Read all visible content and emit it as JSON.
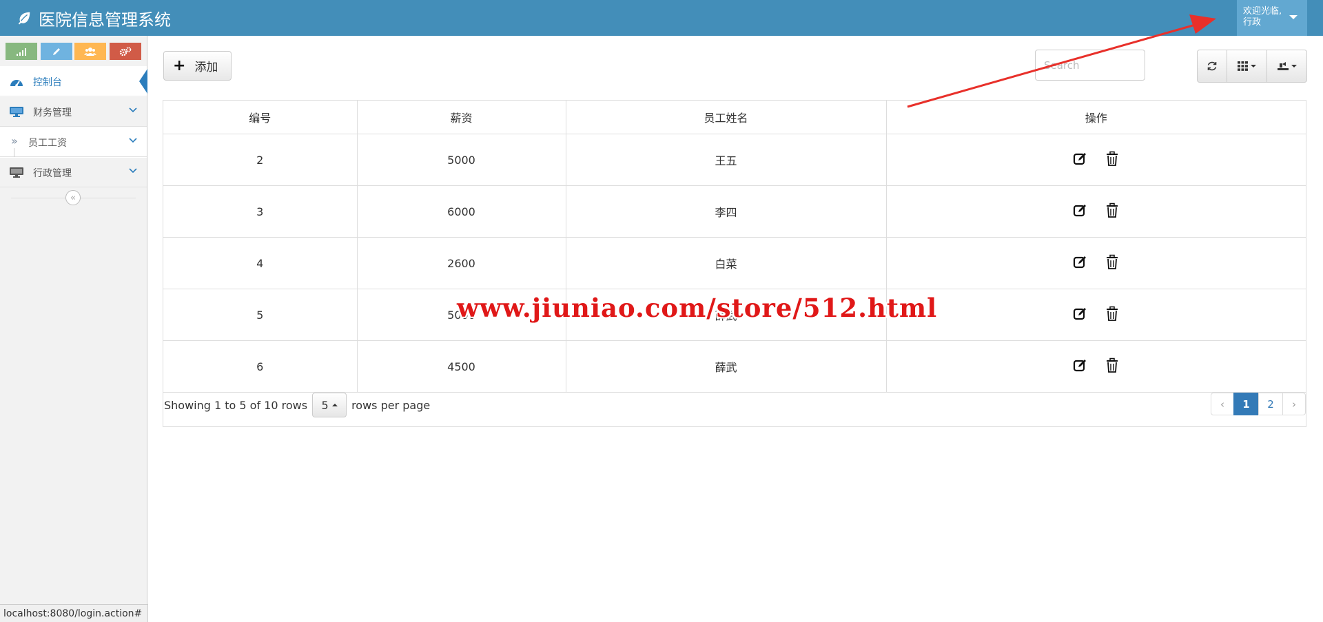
{
  "header": {
    "title": "医院信息管理系统",
    "welcome": "欢迎光临,",
    "username": "行政"
  },
  "sidebar": {
    "shortcuts": [
      {
        "icon": "signal-icon",
        "color": "#87b87f"
      },
      {
        "icon": "pencil-icon",
        "color": "#6fb3e0"
      },
      {
        "icon": "users-icon",
        "color": "#ffb752"
      },
      {
        "icon": "cogs-icon",
        "color": "#d15b47"
      }
    ],
    "items": [
      {
        "label": "控制台",
        "icon": "dashboard-icon"
      },
      {
        "label": "财务管理",
        "icon": "desktop-icon"
      },
      {
        "label": "员工工资",
        "icon": "double-angle-right-icon"
      },
      {
        "label": "行政管理",
        "icon": "desktop-icon"
      }
    ],
    "collapse_symbol": "«"
  },
  "toolbar": {
    "add_label": "添加",
    "search_placeholder": "Search"
  },
  "table": {
    "columns": [
      "编号",
      "薪资",
      "员工姓名",
      "操作"
    ],
    "rows": [
      {
        "id": "2",
        "salary": "5000",
        "name": "王五"
      },
      {
        "id": "3",
        "salary": "6000",
        "name": "李四"
      },
      {
        "id": "4",
        "salary": "2600",
        "name": "白菜"
      },
      {
        "id": "5",
        "salary": "5000",
        "name": "薛武"
      },
      {
        "id": "6",
        "salary": "4500",
        "name": "薛武"
      }
    ]
  },
  "footer": {
    "showing_text": "Showing 1 to 5 of 10 rows",
    "page_size": "5",
    "rows_per_page_text": "rows per page",
    "pages": [
      "‹",
      "1",
      "2",
      "›"
    ],
    "active_page": "1"
  },
  "watermark": "www.jiuniao.com/store/512.html",
  "status_url": "localhost:8080/login.action#",
  "colors": {
    "header": "#438eb9",
    "user_box": "#62a8d1",
    "accent": "#2b7dbc",
    "arrow": "#e8302a",
    "watermark": "#e01818"
  }
}
